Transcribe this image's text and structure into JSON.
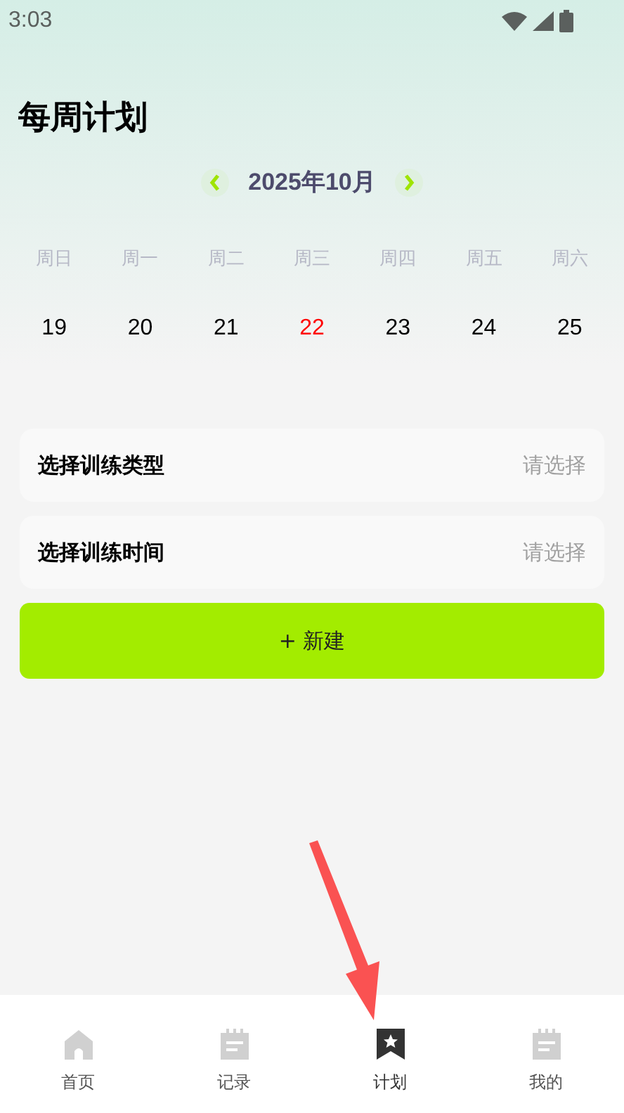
{
  "status_bar": {
    "time": "3:03"
  },
  "title": "每周计划",
  "month": {
    "label": "2025年10月"
  },
  "weekdays": [
    "周日",
    "周一",
    "周二",
    "周三",
    "周四",
    "周五",
    "周六"
  ],
  "days": [
    {
      "label": "19",
      "today": false
    },
    {
      "label": "20",
      "today": false
    },
    {
      "label": "21",
      "today": false
    },
    {
      "label": "22",
      "today": true
    },
    {
      "label": "23",
      "today": false
    },
    {
      "label": "24",
      "today": false
    },
    {
      "label": "25",
      "today": false
    }
  ],
  "form": [
    {
      "label": "选择训练类型",
      "placeholder": "请选择"
    },
    {
      "label": "选择训练时间",
      "placeholder": "请选择"
    }
  ],
  "create_button": "+ 新建",
  "tabs": [
    {
      "label": "首页",
      "kind": "home",
      "selected": false
    },
    {
      "label": "记录",
      "kind": "note",
      "selected": false
    },
    {
      "label": "计划",
      "kind": "bookmark",
      "selected": true
    },
    {
      "label": "我的",
      "kind": "note",
      "selected": false
    }
  ]
}
